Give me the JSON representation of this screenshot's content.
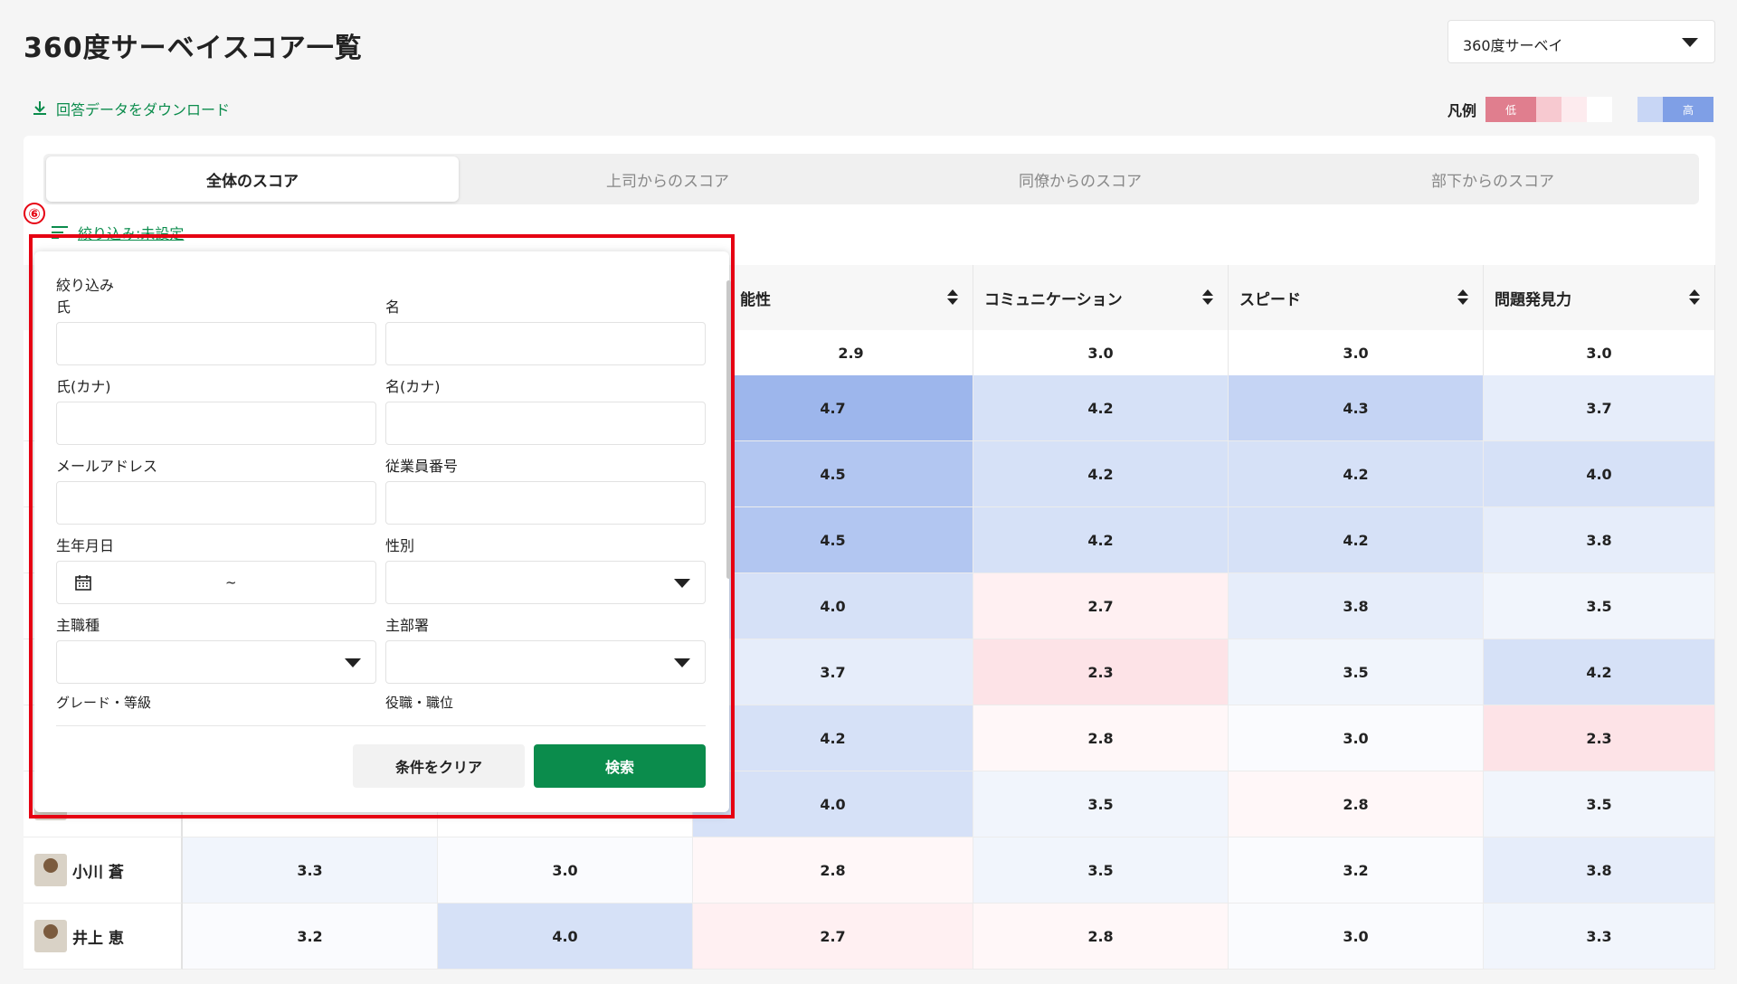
{
  "header": {
    "title": "360度サーベイスコア一覧",
    "survey_select": "360度サーベイ",
    "download_label": "回答データをダウンロード",
    "legend_label": "凡例",
    "legend_low": "低",
    "legend_high": "高"
  },
  "tabs": [
    {
      "label": "全体のスコア"
    },
    {
      "label": "上司からのスコア"
    },
    {
      "label": "同僚からのスコア"
    },
    {
      "label": "部下からのスコア"
    }
  ],
  "filter_toggle": "絞り込み:未設定",
  "annotation_marker": "⑥",
  "table": {
    "visible_header_fragment": "能性",
    "columns": [
      {
        "label": "コミュニケーション"
      },
      {
        "label": "スピード"
      },
      {
        "label": "問題発見力"
      }
    ],
    "averages": [
      "2.9",
      "3.0",
      "3.0",
      "3.0"
    ],
    "rows": [
      {
        "name": "",
        "values": [
          "",
          "",
          "4.7",
          "4.2",
          "4.3",
          "3.7"
        ]
      },
      {
        "name": "",
        "values": [
          "",
          "",
          "4.5",
          "4.2",
          "4.2",
          "4.0"
        ]
      },
      {
        "name": "",
        "values": [
          "",
          "",
          "4.5",
          "4.2",
          "4.2",
          "3.8"
        ]
      },
      {
        "name": "",
        "values": [
          "",
          "",
          "4.0",
          "2.7",
          "3.8",
          "3.5"
        ]
      },
      {
        "name": "",
        "values": [
          "",
          "",
          "3.7",
          "2.3",
          "3.5",
          "4.2"
        ]
      },
      {
        "name": "",
        "values": [
          "",
          "",
          "4.2",
          "2.8",
          "3.0",
          "2.3"
        ]
      },
      {
        "name": "",
        "values": [
          "",
          "",
          "4.0",
          "3.5",
          "2.8",
          "3.5"
        ]
      },
      {
        "name": "小川 蒼",
        "values": [
          "3.3",
          "3.0",
          "2.8",
          "3.5",
          "3.2",
          "3.8"
        ]
      },
      {
        "name": "井上 恵",
        "values": [
          "3.2",
          "4.0",
          "2.7",
          "2.8",
          "3.0",
          "3.3"
        ]
      }
    ]
  },
  "filter_panel": {
    "title": "絞り込み",
    "last_name": "氏",
    "first_name": "名",
    "last_name_kana": "氏(カナ)",
    "first_name_kana": "名(カナ)",
    "email": "メールアドレス",
    "employee_number": "従業員番号",
    "birthdate": "生年月日",
    "birthdate_sep": "~",
    "gender": "性別",
    "main_job": "主職種",
    "main_dept": "主部署",
    "grade": "グレード・等級",
    "position": "役職・職位",
    "clear_button": "条件をクリア",
    "search_button": "検索"
  },
  "colors": {
    "brand_green": "#0b8c4c",
    "annotation_red": "#e60012",
    "legend": [
      "#e07e8e",
      "#f7c9d0",
      "#fdebee",
      "#ffffff",
      "#c8d6f5",
      "#7f9fe6"
    ]
  }
}
